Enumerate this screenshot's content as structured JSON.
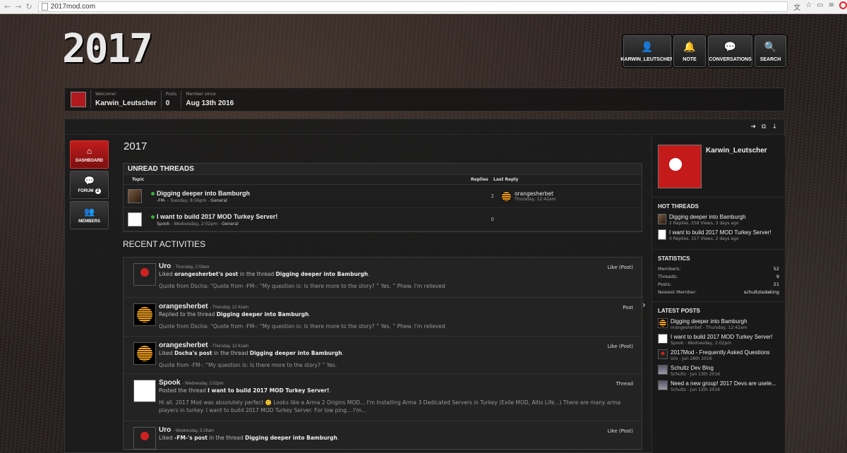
{
  "browser": {
    "url": "2017mod.com"
  },
  "site": {
    "logo": "2017"
  },
  "topnav": [
    {
      "label": "KARWIN_LEUTSCHER",
      "icon": "user-icon"
    },
    {
      "label": "NOTE",
      "icon": "bell-icon"
    },
    {
      "label": "CONVERSATIONS",
      "icon": "chat-icon"
    },
    {
      "label": "SEARCH",
      "icon": "search-icon"
    }
  ],
  "welcome": {
    "greeting_label": "Welcome!",
    "username": "Karwin_Leutscher",
    "posts_label": "Posts",
    "posts_value": "0",
    "member_since_label": "Member since",
    "member_since_value": "Aug 13th 2016"
  },
  "sidenav": [
    {
      "label": "DASHBOARD",
      "icon": "home-icon",
      "active": true
    },
    {
      "label": "FORUM",
      "icon": "chat-icon",
      "badge": "2"
    },
    {
      "label": "MEMBERS",
      "icon": "members-icon"
    }
  ],
  "page_title": "2017",
  "unread": {
    "title": "UNREAD THREADS",
    "col_topic": "Topic",
    "col_replies": "Replies",
    "col_last_reply": "Last Reply",
    "threads": [
      {
        "title": "Digging deeper into Bamburgh",
        "author": "-FM-",
        "time": "Tuesday, 8:56pm",
        "board": "General",
        "replies": "2",
        "last_user": "orangesherbet",
        "last_time": "Thursday, 12:42am"
      },
      {
        "title": "I want to build 2017 MOD Turkey Server!",
        "author": "Spook",
        "time": "Wednesday, 2:02pm",
        "board": "General",
        "replies": "0",
        "last_user": "",
        "last_time": ""
      }
    ]
  },
  "recent": {
    "title": "RECENT ACTIVITIES",
    "items": [
      {
        "user": "Uro",
        "time": "Thursday, 2:03am",
        "pre": "Liked ",
        "bold1": "orangesherbet's post",
        "mid": " in the thread ",
        "bold2": "Digging deeper into Bamburgh",
        "end": ".",
        "quote": "Quote from Dscha: “Quote from -FM-: “My question is: Is there more to the story? ” Yes. ” Phew. I'm relieved",
        "type": "Like (Post)"
      },
      {
        "user": "orangesherbet",
        "time": "Thursday, 12:42am",
        "pre": "Replied to the thread ",
        "bold1": "Digging deeper into Bamburgh",
        "mid": "",
        "bold2": "",
        "end": ".",
        "quote": "Quote from Dscha: “Quote from -FM-: “My question is: Is there more to the story? ” Yes. ” Phew. I'm relieved",
        "type": "Post"
      },
      {
        "user": "orangesherbet",
        "time": "Thursday, 12:41am",
        "pre": "Liked ",
        "bold1": "Dscha's post",
        "mid": " in the thread ",
        "bold2": "Digging deeper into Bamburgh",
        "end": ".",
        "quote": "Quote from -FM-: “My question is: Is there more to the story? ” Yes.",
        "type": "Like (Post)"
      },
      {
        "user": "Spook",
        "time": "Wednesday, 2:02pm",
        "pre": "Posted the thread ",
        "bold1": "I want to build 2017 MOD Turkey Server!",
        "mid": "",
        "bold2": "",
        "end": ".",
        "quote": "Hi all. 2017 Mod was absolutely perfect 🙂 Looks like a Arma 2 Origins MOD... I'm Installing Arma 3 Dedicated Servers in Turkey (Exile MOD, Altis Life...) There are many arma players in turkey. I want to build 2017 MOD Turkey Server. For low ping... I'm...",
        "type": "Thread"
      },
      {
        "user": "Uro",
        "time": "Wednesday, 5:28am",
        "pre": "Liked ",
        "bold1": "-FM-'s post",
        "mid": " in the thread ",
        "bold2": "Digging deeper into Bamburgh",
        "end": ".",
        "quote": "",
        "type": "Like (Post)"
      }
    ]
  },
  "sidebar": {
    "profile_name": "Karwin_Leutscher",
    "hot_title": "HOT THREADS",
    "hot": [
      {
        "title": "Digging deeper into Bamburgh",
        "meta": "2 Replies, 258 Views, 3 days ago"
      },
      {
        "title": "I want to build 2017 MOD Turkey Server!",
        "meta": "0 Replies, 157 Views, 2 days ago"
      }
    ],
    "stats_title": "STATISTICS",
    "stats": [
      {
        "label": "Members:",
        "value": "52"
      },
      {
        "label": "Threads:",
        "value": "9"
      },
      {
        "label": "Posts:",
        "value": "21"
      },
      {
        "label": "Newest Member:",
        "value": "schultzisdaking"
      }
    ],
    "latest_title": "LATEST POSTS",
    "latest": [
      {
        "title": "Digging deeper into Bamburgh",
        "user": "orangesherbet",
        "time": "Thursday, 12:42am"
      },
      {
        "title": "I want to build 2017 MOD Turkey Server!",
        "user": "Spook",
        "time": "Wednesday, 2:02pm"
      },
      {
        "title": "2017Mod - Frequently Asked Questions",
        "user": "Uro",
        "time": "Jun 28th 2016"
      },
      {
        "title": "Schultz Dev Blog",
        "user": "Schultz",
        "time": "Jun 13th 2016"
      },
      {
        "title": "Need a new group! 2017 Devs are usele...",
        "user": "Schultz",
        "time": "Jun 12th 2016"
      }
    ]
  }
}
